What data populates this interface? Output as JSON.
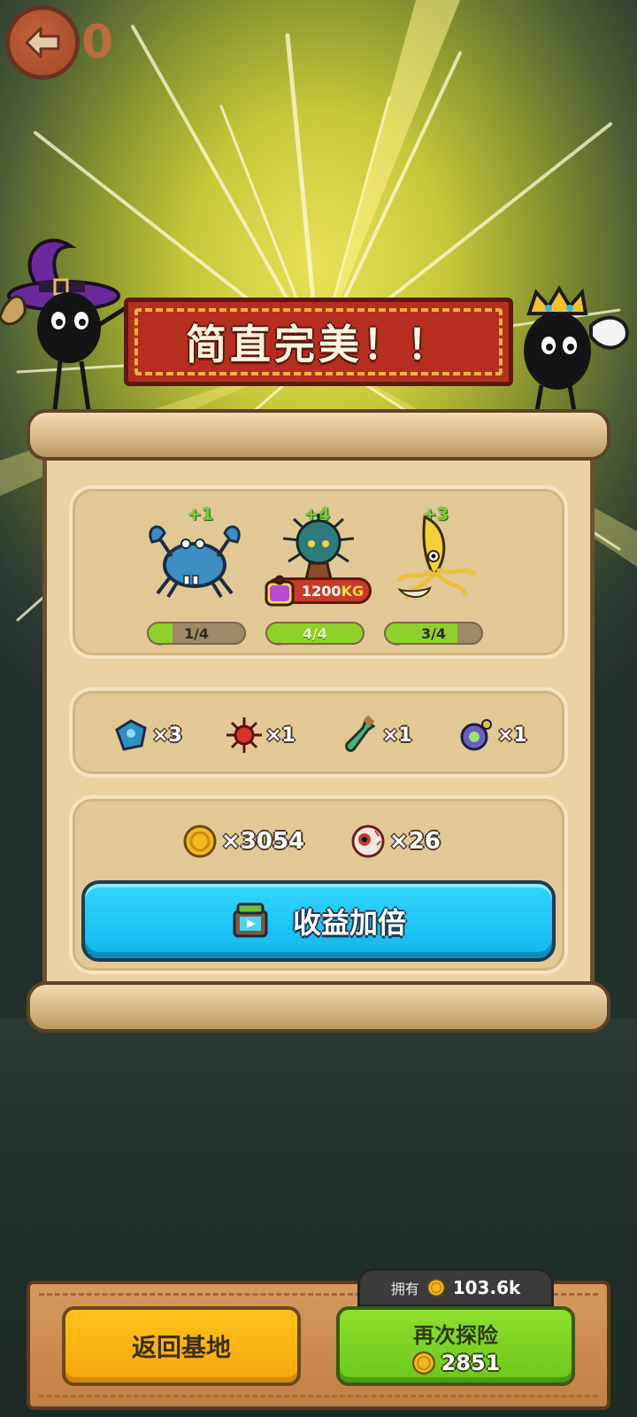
{
  "top_bar": {
    "back_count": "0"
  },
  "banner": {
    "title": "简直完美！！"
  },
  "creatures": [
    {
      "name": "crab",
      "bonus": "+1",
      "progress_text": "1/4",
      "progress": 0.25
    },
    {
      "name": "urchin-tree",
      "bonus": "+4",
      "progress_text": "4/4",
      "progress": 1.0,
      "weight_value": "1200",
      "weight_unit": "KG"
    },
    {
      "name": "banana-octopus",
      "bonus": "+3",
      "progress_text": "3/4",
      "progress": 0.75
    }
  ],
  "items": [
    {
      "icon": "blue-part-icon",
      "qty": "×3"
    },
    {
      "icon": "red-urchin-icon",
      "qty": "×1"
    },
    {
      "icon": "bottle-icon",
      "qty": "×1"
    },
    {
      "icon": "gadget-icon",
      "qty": "×1"
    }
  ],
  "rewards": [
    {
      "icon": "coin-icon",
      "qty": "×3054"
    },
    {
      "icon": "eyeball-icon",
      "qty": "×26"
    }
  ],
  "double_button": {
    "label": "收益加倍"
  },
  "footer": {
    "owned_label": "拥有",
    "owned_value": "103.6k",
    "base_label": "返回基地",
    "again_label": "再次探险",
    "again_cost": "2851"
  },
  "colors": {
    "accent_blue": "#1cc4f2",
    "accent_green": "#7ed424",
    "accent_yellow": "#f9b414",
    "banner_red": "#b52e1f"
  }
}
